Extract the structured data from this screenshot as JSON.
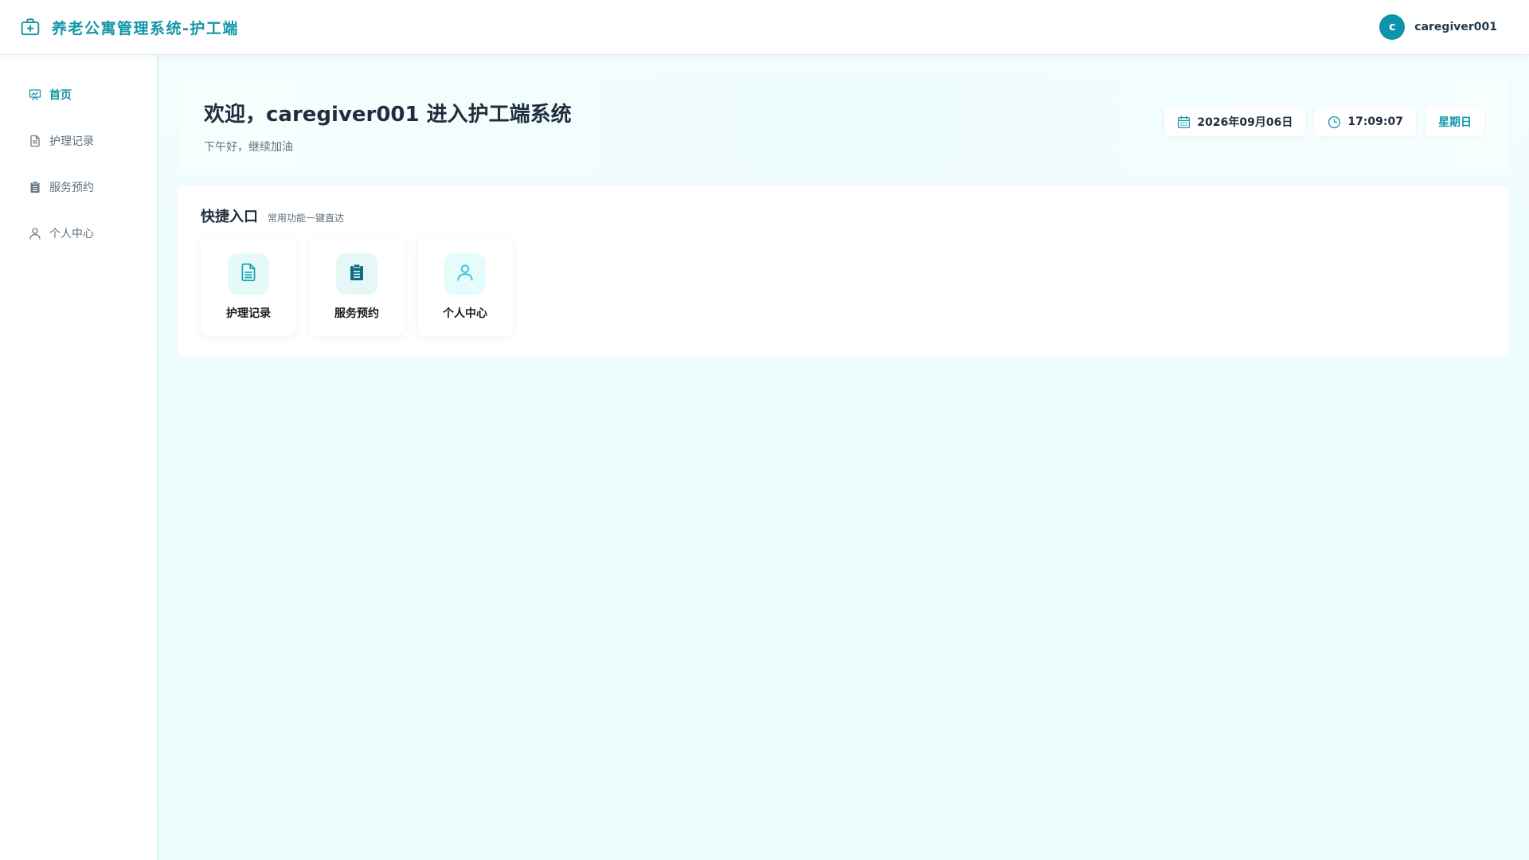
{
  "header": {
    "title": "养老公寓管理系统-护工端",
    "brand_icon": "medical-kit-icon",
    "avatar_initial": "c",
    "username": "caregiver001"
  },
  "sidebar": {
    "items": [
      {
        "label": "首页",
        "icon": "presentation-chart-icon",
        "active": true
      },
      {
        "label": "护理记录",
        "icon": "document-icon",
        "active": false
      },
      {
        "label": "服务预约",
        "icon": "clipboard-icon",
        "active": false
      },
      {
        "label": "个人中心",
        "icon": "user-icon",
        "active": false
      }
    ]
  },
  "welcome": {
    "title": "欢迎，caregiver001 进入护工端系统",
    "subtitle": "下午好，继续加油",
    "date": "2026年09月06日",
    "time": "17:09:07",
    "weekday": "星期日"
  },
  "quick": {
    "title": "快捷入口",
    "subtitle": "常用功能一键直达",
    "cards": [
      {
        "label": "护理记录",
        "icon": "document-icon"
      },
      {
        "label": "服务预约",
        "icon": "clipboard-icon"
      },
      {
        "label": "个人中心",
        "icon": "user-icon"
      }
    ]
  },
  "colors": {
    "accent": "#1396a8",
    "avatar": "#0e93ad",
    "background": "#ebfcfc"
  }
}
